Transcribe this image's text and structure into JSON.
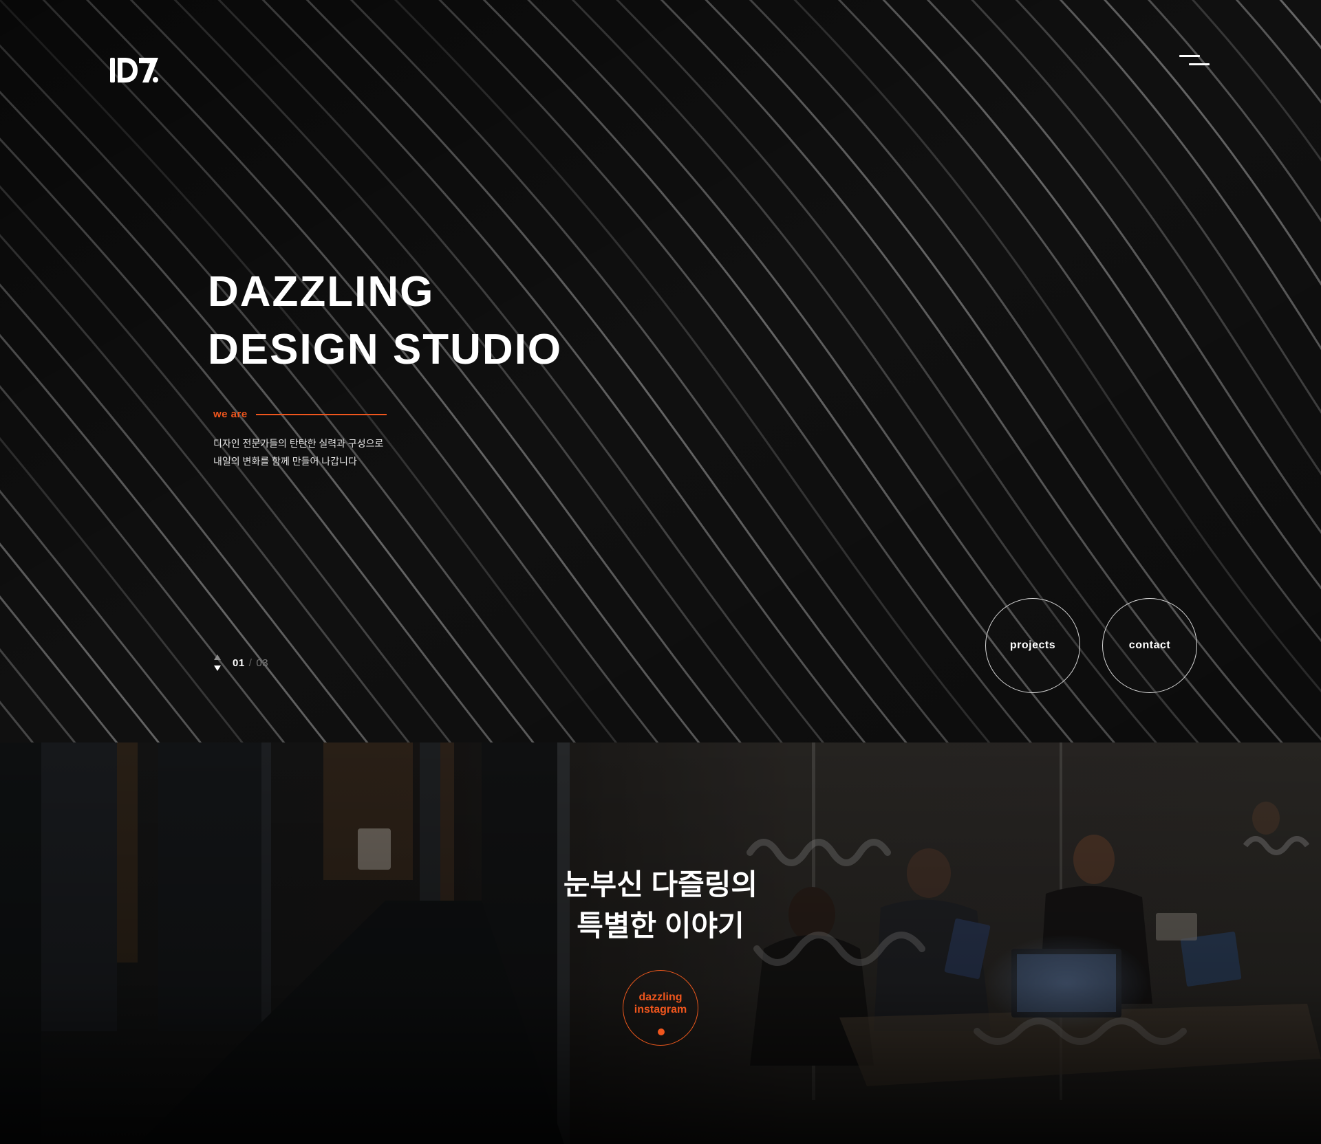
{
  "brand": {
    "logo_text": "DZ",
    "accent_color": "#f0561d"
  },
  "header": {
    "menu_icon": "hamburger-menu-icon"
  },
  "hero": {
    "title_lines": [
      "DAZZLING",
      "DESIGN STUDIO"
    ],
    "we_are_label": "we are",
    "description_lines": [
      "디자인 전문가들의 탄탄한 실력과 구성으로",
      "내일의 변화를 함께 만들어 나갑니다"
    ],
    "slide": {
      "current": "01",
      "separator": "/",
      "total": "03",
      "prev_icon": "arrow-up-icon",
      "next_icon": "arrow-down-icon"
    },
    "buttons": {
      "projects": "projects",
      "contact": "contact"
    }
  },
  "story": {
    "title_lines": [
      "눈부신 다즐링의",
      "특별한 이야기"
    ],
    "instagram_button_lines": [
      "dazzling",
      "instagram"
    ]
  }
}
